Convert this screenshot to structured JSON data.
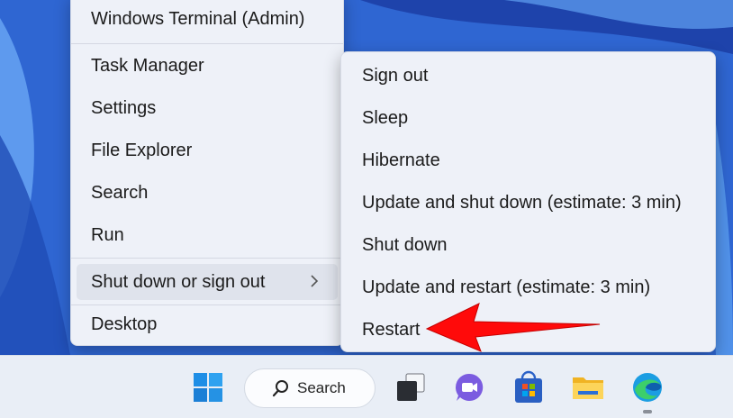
{
  "winx_menu": {
    "items": [
      {
        "label": "Windows Terminal (Admin)"
      },
      {
        "label": "Task Manager"
      },
      {
        "label": "Settings"
      },
      {
        "label": "File Explorer"
      },
      {
        "label": "Search"
      },
      {
        "label": "Run"
      },
      {
        "label": "Shut down or sign out",
        "has_submenu": true,
        "active": true
      },
      {
        "label": "Desktop"
      }
    ]
  },
  "power_submenu": {
    "items": [
      {
        "label": "Sign out"
      },
      {
        "label": "Sleep"
      },
      {
        "label": "Hibernate"
      },
      {
        "label": "Update and shut down (estimate: 3 min)"
      },
      {
        "label": "Shut down"
      },
      {
        "label": "Update and restart (estimate: 3 min)"
      },
      {
        "label": "Restart",
        "highlighted_by_arrow": true
      }
    ]
  },
  "annotation": {
    "arrow_color": "#ff0a0a",
    "points_to": "Restart"
  },
  "taskbar": {
    "search_label": "Search",
    "apps": [
      "start-icon",
      "search-icon",
      "task-view-icon",
      "chat-icon",
      "microsoft-store-icon",
      "file-explorer-icon",
      "edge-icon"
    ],
    "accent": "#2b7ad9"
  }
}
